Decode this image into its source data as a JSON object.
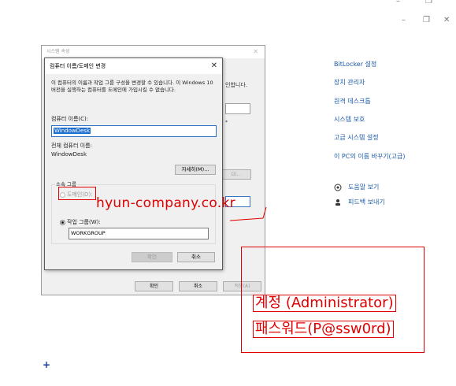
{
  "window_controls": {
    "minimize": "–",
    "restore": "❐",
    "close": "✕"
  },
  "right_links": [
    "BitLocker 설정",
    "장치 관리자",
    "원격 데스크톱",
    "시스템 보호",
    "고급 시스템 설정",
    "이 PC의 이름 바꾸기(고급)"
  ],
  "help_links": [
    {
      "icon": "help-icon",
      "label": "도움말 보기"
    },
    {
      "icon": "feedback-icon",
      "label": "피드백 보내기"
    }
  ],
  "system_properties": {
    "title": "시스템 속성",
    "partial_text_1": "인합니다.",
    "ok": "확인",
    "cancel": "취소",
    "apply": "적용(A)",
    "change_btn_partial": "D)..."
  },
  "rename_dialog": {
    "title": "컴퓨터 이름/도메인 변경",
    "description": "이 컴퓨터의 이름과 작업 그룹 구성을 변경할 수 있습니다. 이 Windows 10 버전을 실행하는 컴퓨터를 도메인에 가입시킬 수 없습니다.",
    "computer_name_label": "컴퓨터 이름(C):",
    "computer_name_value": "WindowDesk",
    "full_name_label": "전체 컴퓨터 이름:",
    "full_name_value": "WindowDesk",
    "more_button": "자세히(M)...",
    "member_of_label": "소속 그룹",
    "domain_label": "도메인(D):",
    "workgroup_label": "작업 그룹(W):",
    "workgroup_value": "WORKGROUP",
    "ok": "확인",
    "cancel": "취소"
  },
  "annotations": {
    "watermark": "hyun-company.co.kr",
    "account_label": "계정 (Administrator)",
    "password_label": "패스워드(P@ssw0rd)",
    "color": "#e00000"
  },
  "plus_sign": "+"
}
